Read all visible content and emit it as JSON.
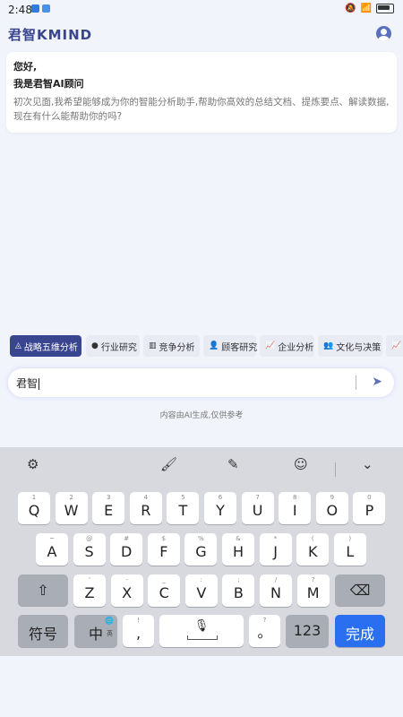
{
  "status": {
    "time": "2:48"
  },
  "app": {
    "title": "君智KMIND"
  },
  "greeting": {
    "hello": "您好,",
    "iam": "我是君智AI顾问",
    "intro": "初次见面,我希望能够成为你的智能分析助手,帮助你高效的总结文档、提炼要点、解读数据,现在有什么能帮助你的吗?"
  },
  "chips": [
    {
      "label": "战略五维分析",
      "icon": "pyramid-icon",
      "glyph": "◬"
    },
    {
      "label": "行业研究",
      "icon": "circle-icon",
      "glyph": "●"
    },
    {
      "label": "竞争分析",
      "icon": "bar-chart-icon",
      "glyph": "▥"
    },
    {
      "label": "顾客研究",
      "icon": "person-icon",
      "glyph": "👤"
    },
    {
      "label": "企业分析",
      "icon": "line-chart-icon",
      "glyph": "📈"
    },
    {
      "label": "文化与决策",
      "icon": "people-icon",
      "glyph": "👥"
    }
  ],
  "input": {
    "value": "君智"
  },
  "disclaimer": "内容由AI生成,仅供参考",
  "keyboard": {
    "row1": [
      {
        "k": "Q",
        "s": "1"
      },
      {
        "k": "W",
        "s": "2"
      },
      {
        "k": "E",
        "s": "3"
      },
      {
        "k": "R",
        "s": "4"
      },
      {
        "k": "T",
        "s": "5"
      },
      {
        "k": "Y",
        "s": "6"
      },
      {
        "k": "U",
        "s": "7"
      },
      {
        "k": "I",
        "s": "8"
      },
      {
        "k": "O",
        "s": "9"
      },
      {
        "k": "P",
        "s": "0"
      }
    ],
    "row2": [
      {
        "k": "A",
        "s": "~"
      },
      {
        "k": "S",
        "s": "@"
      },
      {
        "k": "D",
        "s": "#"
      },
      {
        "k": "F",
        "s": "$"
      },
      {
        "k": "G",
        "s": "%"
      },
      {
        "k": "H",
        "s": "&"
      },
      {
        "k": "J",
        "s": "*"
      },
      {
        "k": "K",
        "s": "("
      },
      {
        "k": "L",
        "s": ")"
      }
    ],
    "row3": [
      {
        "k": "Z",
        "s": "'"
      },
      {
        "k": "X",
        "s": "-"
      },
      {
        "k": "C",
        "s": "_"
      },
      {
        "k": "V",
        "s": ":"
      },
      {
        "k": "B",
        "s": ";"
      },
      {
        "k": "N",
        "s": "/"
      },
      {
        "k": "M",
        "s": "?"
      }
    ],
    "symbols": "符号",
    "lang": "中",
    "lang_sub": "英",
    "comma": ",",
    "comma_sub": "!",
    "period": "。",
    "period_sub": "?",
    "numbers": "123",
    "done": "完成"
  }
}
